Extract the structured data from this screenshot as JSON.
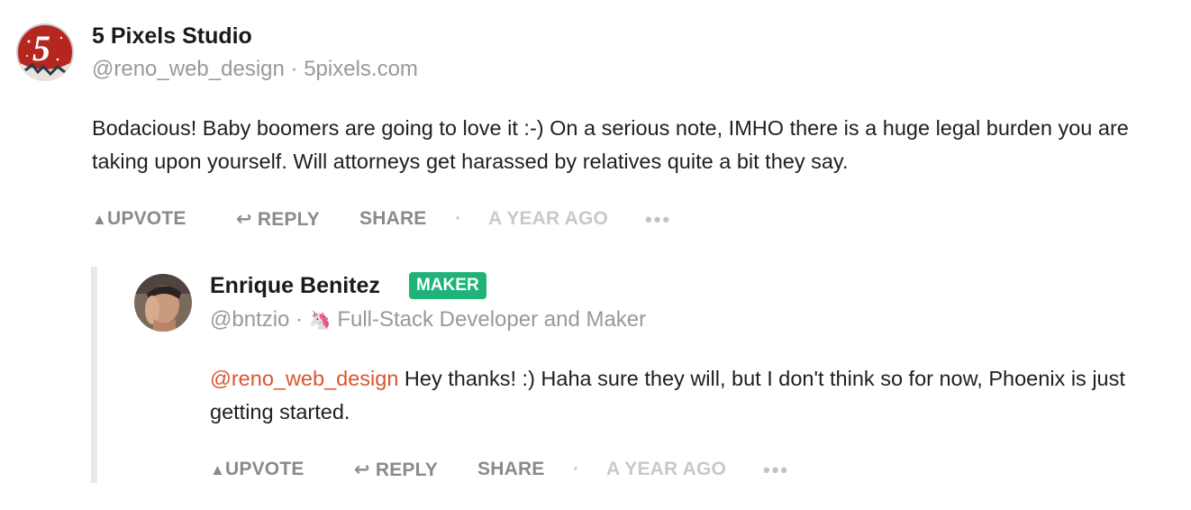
{
  "comment1": {
    "author_name": "5 Pixels Studio",
    "handle": "@reno_web_design",
    "separator": "·",
    "website": "5pixels.com",
    "avatar_text": "5",
    "body": "Bodacious! Baby boomers are going to love it :-) On a serious note, IMHO there is a huge legal burden you are taking upon yourself. Will attorneys get harassed by relatives quite a bit they say.",
    "actions": {
      "upvote": "UPVOTE",
      "reply": "REPLY",
      "share": "SHARE",
      "separator": "·",
      "timestamp": "A YEAR AGO",
      "more": "•••"
    }
  },
  "comment2": {
    "author_name": "Enrique Benitez",
    "badge": "MAKER",
    "handle": "@bntzio",
    "separator": "·",
    "emoji": "🦄",
    "headline": "Full-Stack Developer and Maker",
    "mention": "@reno_web_design",
    "body": " Hey thanks! :) Haha sure they will, but I don't think so for now, Phoenix is just getting started.",
    "actions": {
      "upvote": "UPVOTE",
      "reply": "REPLY",
      "share": "SHARE",
      "separator": "·",
      "timestamp": "A YEAR AGO",
      "more": "•••"
    }
  },
  "colors": {
    "badge": "#1fb378",
    "mention": "#da552f",
    "muted": "#999999",
    "action": "#8a8a8a"
  }
}
